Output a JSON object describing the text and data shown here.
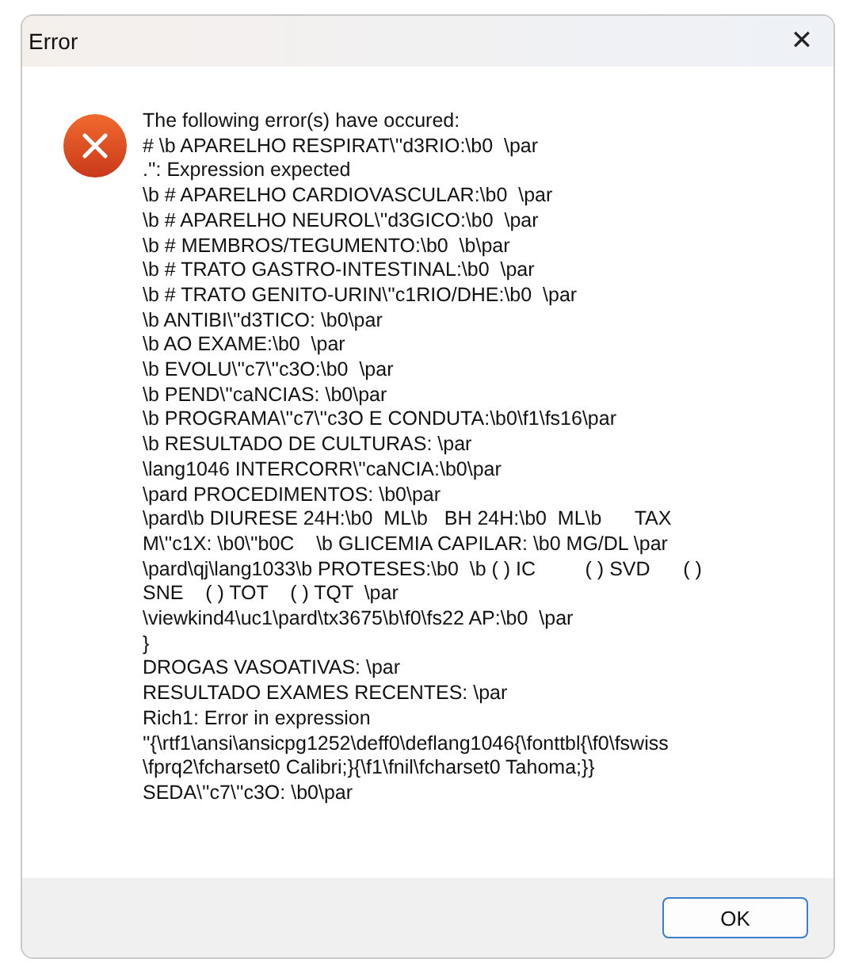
{
  "window": {
    "title": "Error",
    "close": "✕"
  },
  "message": {
    "lines": [
      "The following error(s) have occured:",
      "# \\b APARELHO RESPIRAT\\''d3RIO:\\b0  \\par",
      ".'': Expression expected",
      "\\b # APARELHO CARDIOVASCULAR:\\b0  \\par",
      "\\b # APARELHO NEUROL\\''d3GICO:\\b0  \\par",
      "\\b # MEMBROS/TEGUMENTO:\\b0  \\b\\par",
      "\\b # TRATO GASTRO-INTESTINAL:\\b0  \\par",
      "\\b # TRATO GENITO-URIN\\''c1RIO/DHE:\\b0  \\par",
      "\\b ANTIBI\\''d3TICO: \\b0\\par",
      "\\b AO EXAME:\\b0  \\par",
      "\\b EVOLU\\''c7\\''c3O:\\b0  \\par",
      "\\b PEND\\''caNCIAS: \\b0\\par",
      "\\b PROGRAMA\\''c7\\''c3O E CONDUTA:\\b0\\f1\\fs16\\par",
      "\\b RESULTADO DE CULTURAS: \\par",
      "\\lang1046 INTERCORR\\''caNCIA:\\b0\\par",
      "\\pard PROCEDIMENTOS: \\b0\\par",
      "\\pard\\b DIURESE 24H:\\b0  ML\\b   BH 24H:\\b0  ML\\b      TAX",
      "M\\''c1X: \\b0\\''b0C    \\b GLICEMIA CAPILAR: \\b0 MG/DL \\par",
      "\\pard\\qj\\lang1033\\b PROTESES:\\b0  \\b ( ) IC         ( ) SVD      ( )",
      "SNE    ( ) TOT    ( ) TQT  \\par",
      "\\viewkind4\\uc1\\pard\\tx3675\\b\\f0\\fs22 AP:\\b0  \\par",
      "}",
      "DROGAS VASOATIVAS: \\par",
      "RESULTADO EXAMES RECENTES: \\par",
      "Rich1: Error in expression",
      "''{\\rtf1\\ansi\\ansicpg1252\\deff0\\deflang1046{\\fonttbl{\\f0\\fswiss",
      "\\fprq2\\fcharset0 Calibri;}{\\f1\\fnil\\fcharset0 Tahoma;}}",
      "SEDA\\''c7\\''c3O: \\b0\\par"
    ]
  },
  "buttons": [
    "OK"
  ]
}
